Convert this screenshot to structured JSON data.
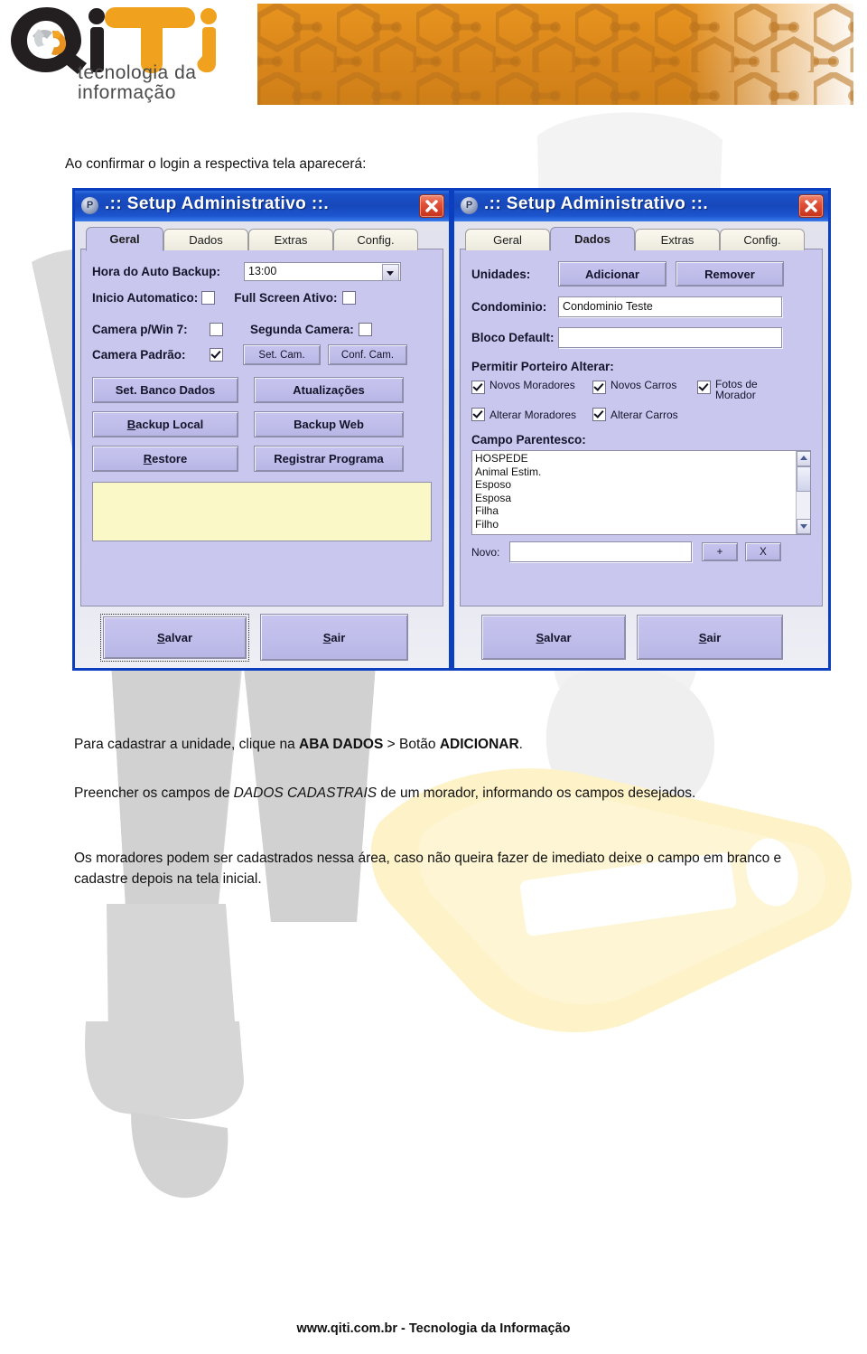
{
  "brand": {
    "logo_text": "QiTi",
    "logo_sub_line1": "tecnologia da",
    "logo_sub_line2": "informação"
  },
  "document": {
    "intro_line": "Ao confirmar o login a respectiva tela aparecerá:",
    "para_1_prefix": "Para cadastrar a unidade, clique na ",
    "para_1_bold_1": "ABA DADOS",
    "para_1_mid": " > Botão ",
    "para_1_bold_2": "ADICIONAR",
    "para_1_suffix": ".",
    "para_2_prefix": "Preencher os campos de ",
    "para_2_italic": "DADOS CADASTRAIS",
    "para_2_suffix": " de um morador, informando os campos desejados.",
    "para_3": "Os moradores podem ser cadastrados nessa área, caso não queira fazer de imediato deixe o campo em branco e cadastre depois na tela inicial.",
    "footer": "www.qiti.com.br - Tecnologia da Informação"
  },
  "dialog_left": {
    "title": ".:: Setup Administrativo ::.",
    "icon_name": "app-icon",
    "close_label": "Fechar",
    "tabs": [
      {
        "label": "Geral",
        "active": true
      },
      {
        "label": "Dados",
        "active": false
      },
      {
        "label": "Extras",
        "active": false
      },
      {
        "label": "Config.",
        "active": false
      }
    ],
    "fields": {
      "hora_backup_label": "Hora do Auto Backup:",
      "hora_backup_value": "13:00",
      "inicio_automatico_label": "Inicio Automatico:",
      "inicio_automatico_checked": false,
      "full_screen_label": "Full Screen Ativo:",
      "full_screen_checked": false,
      "camera_win7_label": "Camera p/Win 7:",
      "camera_win7_checked": false,
      "segunda_camera_label": "Segunda Camera:",
      "segunda_camera_checked": false,
      "camera_padrao_label": "Camera Padrão:",
      "camera_padrao_checked": true,
      "set_cam_label": "Set. Cam.",
      "conf_cam_label": "Conf. Cam.",
      "memo_value": ""
    },
    "buttons": {
      "set_banco_dados": "Set. Banco Dados",
      "atualizacoes": "Atualizações",
      "backup_local": "Backup Local",
      "backup_web": "Backup Web",
      "restore": "Restore",
      "registrar_programa": "Registrar Programa",
      "salvar": "Salvar",
      "sair": "Sair"
    }
  },
  "dialog_right": {
    "title": ".:: Setup Administrativo ::.",
    "icon_name": "app-icon",
    "close_label": "Fechar",
    "tabs": [
      {
        "label": "Geral",
        "active": false
      },
      {
        "label": "Dados",
        "active": true
      },
      {
        "label": "Extras",
        "active": false
      },
      {
        "label": "Config.",
        "active": false
      }
    ],
    "fields": {
      "unidades_label": "Unidades:",
      "adicionar_label": "Adicionar",
      "remover_label": "Remover",
      "condominio_label": "Condominio:",
      "condominio_value": "Condominio Teste",
      "bloco_default_label": "Bloco Default:",
      "bloco_default_value": "",
      "permitir_label": "Permitir Porteiro Alterar:",
      "permissions": [
        {
          "label": "Novos Moradores",
          "checked": true
        },
        {
          "label": "Novos Carros",
          "checked": true
        },
        {
          "label": "Fotos de Morador",
          "checked": true
        },
        {
          "label": "Alterar Moradores",
          "checked": true
        },
        {
          "label": "Alterar Carros",
          "checked": true
        }
      ],
      "campo_parentesco_label": "Campo Parentesco:",
      "parentesco_items": [
        "HOSPEDE",
        "Animal Estim.",
        "Esposo",
        "Esposa",
        "Filha",
        "Filho"
      ],
      "novo_label": "Novo:",
      "novo_value": "",
      "add_btn_label": "+",
      "del_btn_label": "X"
    },
    "buttons": {
      "salvar": "Salvar",
      "sair": "Sair"
    }
  },
  "colors": {
    "titlebar_blue": "#1748bb",
    "dialog_border": "#0b3fbf",
    "tab_lavender": "#c9c7ee",
    "tab_inactive": "#f3f1e3",
    "close_red": "#c63118",
    "memo_yellow": "#fbf8c8",
    "banner_orange": "#d9861b"
  }
}
